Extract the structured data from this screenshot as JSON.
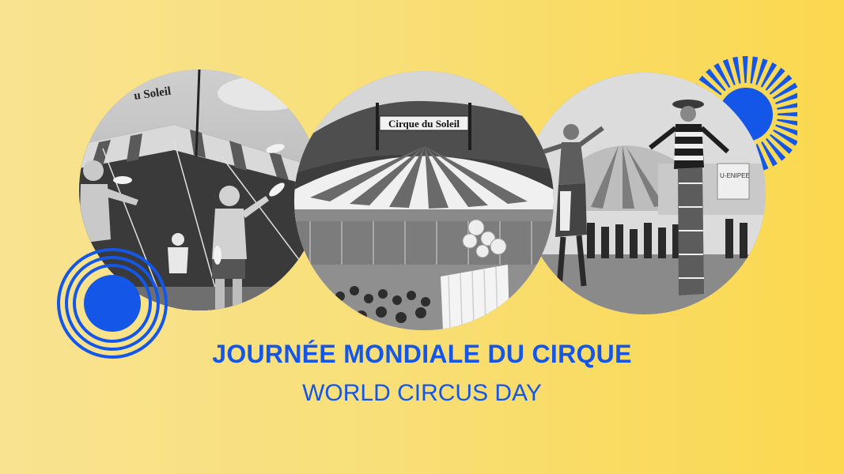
{
  "heading_fr": "JOURNÉE MONDIALE DU CIRQUE",
  "heading_en": "WORLD CIRCUS DAY",
  "photos": {
    "left_sign": "u Soleil",
    "middle_sign": "Cirque du Soleil",
    "right_sign": "U-ENIPEE"
  },
  "colors": {
    "accent_blue": "#1457e8",
    "background_start": "#f9e391",
    "background_end": "#fbd84e"
  },
  "icons": {
    "circle_decoration": "concentric-arc-icon",
    "sun_decoration": "sunburst-icon"
  }
}
